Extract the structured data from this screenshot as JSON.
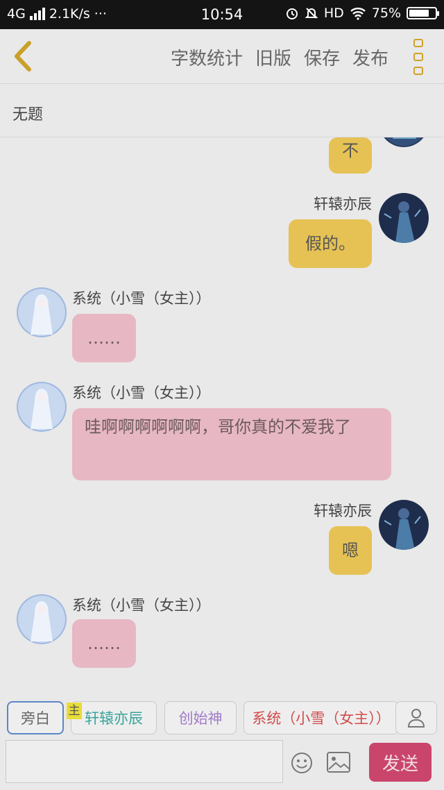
{
  "status_bar": {
    "network": "4G",
    "speed": "2.1K/s",
    "dots": "···",
    "time": "10:54",
    "hd": "HD",
    "battery": "75%"
  },
  "header": {
    "actions": [
      "字数统计",
      "旧版",
      "保存",
      "发布"
    ]
  },
  "title": "无题",
  "messages": [
    {
      "side": "right",
      "text": "不"
    },
    {
      "side": "right",
      "name": "轩辕亦辰",
      "text": "假的。"
    },
    {
      "side": "left",
      "name": "系统（小雪（女主））",
      "text": "……"
    },
    {
      "side": "left",
      "name": "系统（小雪（女主））",
      "text": "哇啊啊啊啊啊啊，哥你真的不爱我了"
    },
    {
      "side": "right",
      "name": "轩辕亦辰",
      "text": "嗯"
    },
    {
      "side": "left",
      "name": "系统（小雪（女主））",
      "text": "……"
    }
  ],
  "roles": {
    "items": [
      {
        "label": "旁白",
        "color": "#666666"
      },
      {
        "label": "轩辕亦辰",
        "color": "#3aa39b"
      },
      {
        "label": "创始神",
        "color": "#a07ac8"
      },
      {
        "label": "系统（小雪（女主））",
        "color": "#d24a4a"
      }
    ],
    "main_badge": "主"
  },
  "input": {
    "placeholder": ""
  },
  "send_label": "发送",
  "colors": {
    "bubble_right": "#e6c254",
    "bubble_left": "#e8b7c4",
    "send": "#c9456c",
    "accent": "#d0a12a"
  }
}
